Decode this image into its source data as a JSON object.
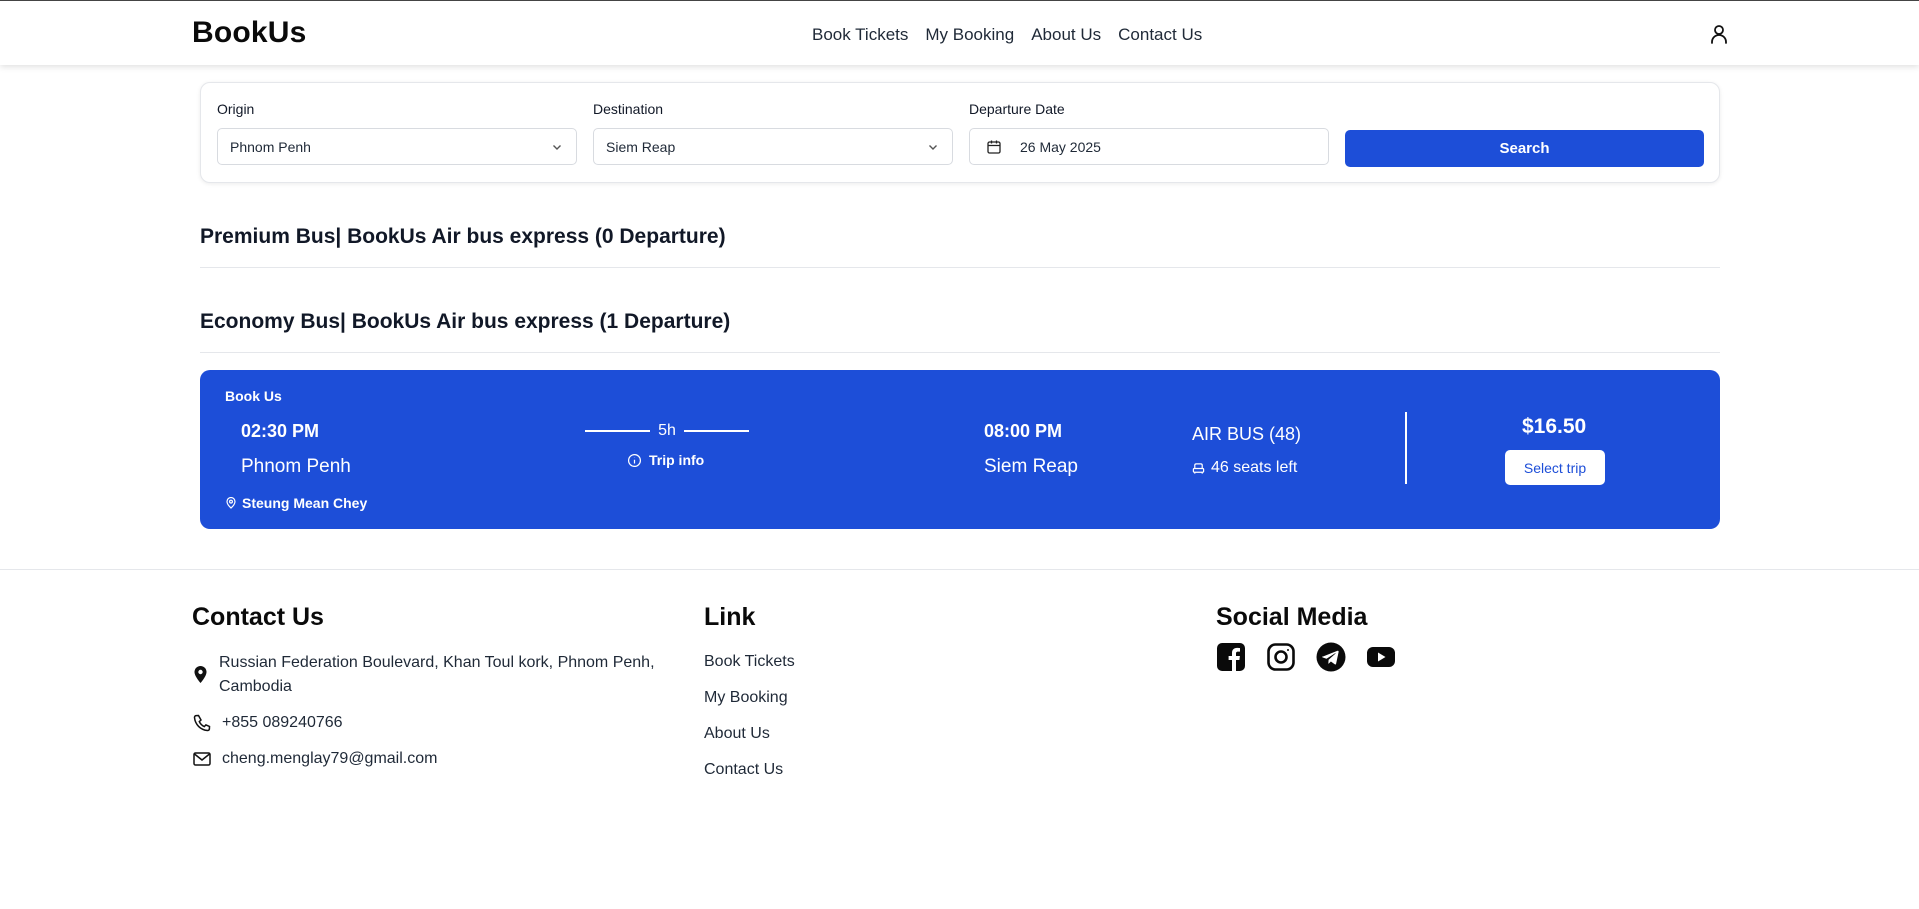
{
  "header": {
    "logo": "BookUs",
    "nav": [
      "Book Tickets",
      "My Booking",
      "About Us",
      "Contact Us"
    ],
    "user_icon": "user-icon"
  },
  "search": {
    "origin_label": "Origin",
    "origin_value": "Phnom Penh",
    "destination_label": "Destination",
    "destination_value": "Siem Reap",
    "date_label": "Departure Date",
    "date_value": "26 May 2025",
    "button_label": "Search"
  },
  "sections": {
    "premium_title": "Premium Bus| BookUs Air bus express (0 Departure)",
    "economy_title": "Economy Bus| BookUs Air bus express (1 Departure)"
  },
  "trip": {
    "operator": "Book Us",
    "departure_time": "02:30 PM",
    "departure_city": "Phnom Penh",
    "pickup": "Steung Mean Chey",
    "duration": "5h",
    "trip_info": "Trip info",
    "arrival_time": "08:00 PM",
    "arrival_city": "Siem Reap",
    "bus_type": "AIR BUS (48)",
    "seats_left": "46 seats left",
    "price": "$16.50",
    "select_label": "Select trip"
  },
  "footer": {
    "contact_title": "Contact Us",
    "address_line1": "Russian Federation Boulevard, Khan Toul kork, Phnom Penh,",
    "address_line2": "Cambodia",
    "phone": "+855 089240766",
    "email": "cheng.menglay79@gmail.com",
    "link_title": "Link",
    "links": [
      "Book Tickets",
      "My Booking",
      "About Us",
      "Contact Us"
    ],
    "social_title": "Social Media",
    "social_icons": [
      "facebook-icon",
      "instagram-icon",
      "telegram-icon",
      "youtube-icon"
    ]
  },
  "colors": {
    "primary": "#1d4ed8",
    "text": "#111827"
  }
}
